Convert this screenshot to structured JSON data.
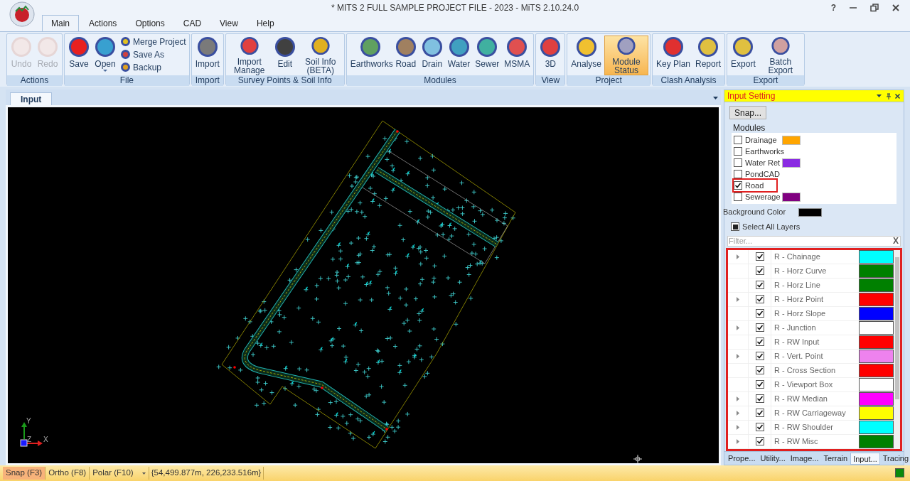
{
  "window": {
    "title": "* MITS 2 FULL SAMPLE PROJECT FILE - 2023 - MiTS 2.10.24.0",
    "help": "?"
  },
  "menu_tabs": [
    {
      "label": "Main",
      "selected": true
    },
    {
      "label": "Actions",
      "selected": false
    },
    {
      "label": "Options",
      "selected": false
    },
    {
      "label": "CAD",
      "selected": false
    },
    {
      "label": "View",
      "selected": false
    },
    {
      "label": "Help",
      "selected": false
    }
  ],
  "ribbon_groups": [
    {
      "label": "Actions",
      "buttons": [
        {
          "label": "Undo",
          "kind": "large",
          "disabled": true,
          "selected": false
        },
        {
          "label": "Redo",
          "kind": "large",
          "disabled": true,
          "selected": false
        }
      ]
    },
    {
      "label": "File",
      "buttons": [
        {
          "label": "Save",
          "kind": "large",
          "disabled": false,
          "selected": false
        },
        {
          "label": "Open",
          "kind": "split",
          "disabled": false,
          "selected": false
        },
        {
          "label": "Merge Project",
          "kind": "small",
          "disabled": false,
          "selected": false
        },
        {
          "label": "Save As",
          "kind": "small",
          "disabled": false,
          "selected": false
        },
        {
          "label": "Backup",
          "kind": "small",
          "disabled": false,
          "selected": false
        }
      ]
    },
    {
      "label": "Import",
      "buttons": [
        {
          "label": "Import",
          "kind": "large",
          "disabled": false,
          "selected": false
        }
      ]
    },
    {
      "label": "Survey Points & Soil Info",
      "buttons": [
        {
          "label": "Import Manage",
          "kind": "large",
          "disabled": false,
          "selected": false
        },
        {
          "label": "Edit",
          "kind": "large",
          "disabled": false,
          "selected": false
        },
        {
          "label": "Soil Info (BETA)",
          "kind": "large",
          "disabled": false,
          "selected": false
        }
      ]
    },
    {
      "label": "Modules",
      "buttons": [
        {
          "label": "Earthworks",
          "kind": "large",
          "disabled": false,
          "selected": false
        },
        {
          "label": "Road",
          "kind": "large",
          "disabled": false,
          "selected": false
        },
        {
          "label": "Drain",
          "kind": "large",
          "disabled": false,
          "selected": false
        },
        {
          "label": "Water",
          "kind": "large",
          "disabled": false,
          "selected": false
        },
        {
          "label": "Sewer",
          "kind": "large",
          "disabled": false,
          "selected": false
        },
        {
          "label": "MSMA",
          "kind": "large",
          "disabled": false,
          "selected": false
        }
      ]
    },
    {
      "label": "View",
      "buttons": [
        {
          "label": "3D",
          "kind": "large",
          "disabled": false,
          "selected": false
        }
      ]
    },
    {
      "label": "Project",
      "buttons": [
        {
          "label": "Analyse",
          "kind": "large",
          "disabled": false,
          "selected": false
        },
        {
          "label": "Module Status",
          "kind": "large",
          "disabled": false,
          "selected": true
        }
      ]
    },
    {
      "label": "Clash Analysis",
      "buttons": [
        {
          "label": "Key Plan",
          "kind": "large",
          "disabled": false,
          "selected": false
        },
        {
          "label": "Report",
          "kind": "large",
          "disabled": false,
          "selected": false
        }
      ]
    },
    {
      "label": "Export",
      "buttons": [
        {
          "label": "Export",
          "kind": "large",
          "disabled": false,
          "selected": false
        },
        {
          "label": "Batch Export",
          "kind": "large",
          "disabled": false,
          "selected": false
        }
      ]
    }
  ],
  "document_tab": {
    "label": "Input",
    "selected": true
  },
  "canvas": {
    "axis_labels": [
      "Y",
      "Z",
      "X"
    ]
  },
  "panel": {
    "title": "Input Setting",
    "snap_button": "Snap...",
    "modules_label": "Modules",
    "modules": [
      {
        "label": "Drainage",
        "checked": false,
        "highlighted": false,
        "color": "#ffa500"
      },
      {
        "label": "Earthworks",
        "checked": false,
        "highlighted": false
      },
      {
        "label": "Water Ret",
        "checked": false,
        "highlighted": false,
        "color": "#8a2be2"
      },
      {
        "label": "PondCAD",
        "checked": false,
        "highlighted": false
      },
      {
        "label": "Road",
        "checked": true,
        "highlighted": true
      },
      {
        "label": "Sewerage",
        "checked": false,
        "highlighted": false,
        "color": "#800080"
      }
    ],
    "background": {
      "label": "Background Color",
      "color": "#000000"
    },
    "select_all": {
      "label": "Select All Layers",
      "indeterminate": true
    },
    "filter": {
      "placeholder": "Filter...",
      "clear": "X"
    },
    "layers_highlighted": true,
    "layers": [
      {
        "name": "R - Chainage",
        "expandable": true,
        "checked": true,
        "color": "#00ffff"
      },
      {
        "name": "R - Horz Curve",
        "expandable": false,
        "checked": true,
        "color": "#008000"
      },
      {
        "name": "R - Horz Line",
        "expandable": false,
        "checked": true,
        "color": "#008000"
      },
      {
        "name": "R - Horz Point",
        "expandable": true,
        "checked": true,
        "color": "#ff0000"
      },
      {
        "name": "R - Horz Slope",
        "expandable": false,
        "checked": true,
        "color": "#0000ff"
      },
      {
        "name": "R - Junction",
        "expandable": true,
        "checked": true,
        "color": "#ffffff"
      },
      {
        "name": "R - RW Input",
        "expandable": false,
        "checked": true,
        "color": "#ff0000"
      },
      {
        "name": "R - Vert. Point",
        "expandable": true,
        "checked": true,
        "color": "#ee82ee"
      },
      {
        "name": "R - Cross Section",
        "expandable": false,
        "checked": true,
        "color": "#ff0000"
      },
      {
        "name": "R - Viewport Box",
        "expandable": false,
        "checked": true,
        "color": "#ffffff"
      },
      {
        "name": "R - RW Median",
        "expandable": true,
        "checked": true,
        "color": "#ff00ff"
      },
      {
        "name": "R - RW Carriageway",
        "expandable": true,
        "checked": true,
        "color": "#ffff00"
      },
      {
        "name": "R - RW Shoulder",
        "expandable": true,
        "checked": true,
        "color": "#00ffff"
      },
      {
        "name": "R - RW Misc",
        "expandable": true,
        "checked": true,
        "color": "#008000"
      }
    ],
    "bottom_tabs": [
      {
        "label": "Prope...",
        "selected": false
      },
      {
        "label": "Utility...",
        "selected": false
      },
      {
        "label": "Image...",
        "selected": false
      },
      {
        "label": "Terrain",
        "selected": false
      },
      {
        "label": "Input...",
        "selected": true
      },
      {
        "label": "Tracing",
        "selected": false
      }
    ]
  },
  "status_bar": {
    "items": [
      {
        "label": "Snap (F3)",
        "selected": true,
        "dropdown": false
      },
      {
        "label": "Ortho (F8)",
        "selected": false,
        "dropdown": false
      },
      {
        "label": "Polar (F10)",
        "selected": false,
        "dropdown": true
      }
    ],
    "coordinates": "{54,499.877m, 226,233.516m}"
  }
}
